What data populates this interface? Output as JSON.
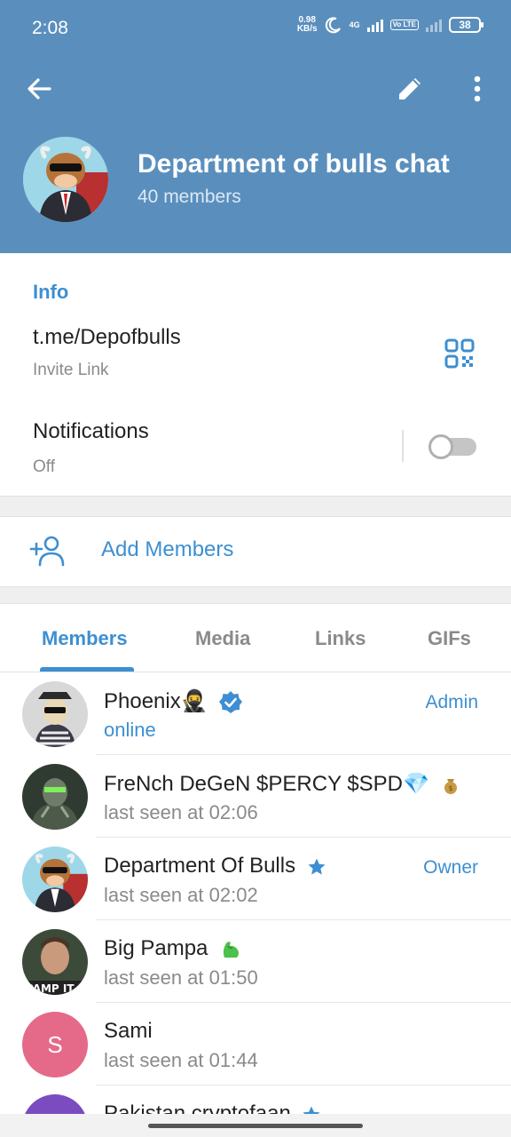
{
  "status_bar": {
    "time": "2:08",
    "net_speed_value": "0.98",
    "net_speed_unit": "KB/s",
    "net_type": "4G",
    "volte": "Vo LTE",
    "battery": "38"
  },
  "header": {
    "back_icon": "arrow-left-icon",
    "edit_icon": "pencil-icon",
    "more_icon": "more-vertical-icon",
    "title": "Department of bulls chat",
    "subtitle": "40 members",
    "color": "#5a8fbd"
  },
  "info": {
    "heading": "Info",
    "link": "t.me/Depofbulls",
    "link_label": "Invite Link",
    "qr_icon": "qr-code-icon",
    "notifications_label": "Notifications",
    "notifications_value": "Off",
    "notifications_on": false
  },
  "add_members": {
    "label": "Add Members",
    "icon": "add-person-icon"
  },
  "tabs": [
    {
      "label": "Members",
      "active": true
    },
    {
      "label": "Media",
      "active": false
    },
    {
      "label": "Links",
      "active": false
    },
    {
      "label": "GIFs",
      "active": false
    }
  ],
  "members": [
    {
      "name": "Phoenix🥷",
      "status": "online",
      "role": "Admin",
      "badge": "verified-icon"
    },
    {
      "name": "FreNch DeGeN $PERCY $SPD💎",
      "status": "last seen at 02:06",
      "role": "",
      "badge": "bag-icon"
    },
    {
      "name": "Department Of Bulls",
      "status": "last seen at 02:02",
      "role": "Owner",
      "badge": "star-icon"
    },
    {
      "name": "Big Pampa",
      "status": "last seen at 01:50",
      "role": "",
      "badge": "flexed-biceps-icon"
    },
    {
      "name": "Sami",
      "status": "last seen at 01:44",
      "role": "",
      "badge": "",
      "initial": "S"
    },
    {
      "name": "Pakistan cryptofaan",
      "status": "",
      "role": "",
      "badge": "star-icon"
    }
  ],
  "colors": {
    "accent": "#3d8fd1",
    "header": "#5a8fbd"
  }
}
